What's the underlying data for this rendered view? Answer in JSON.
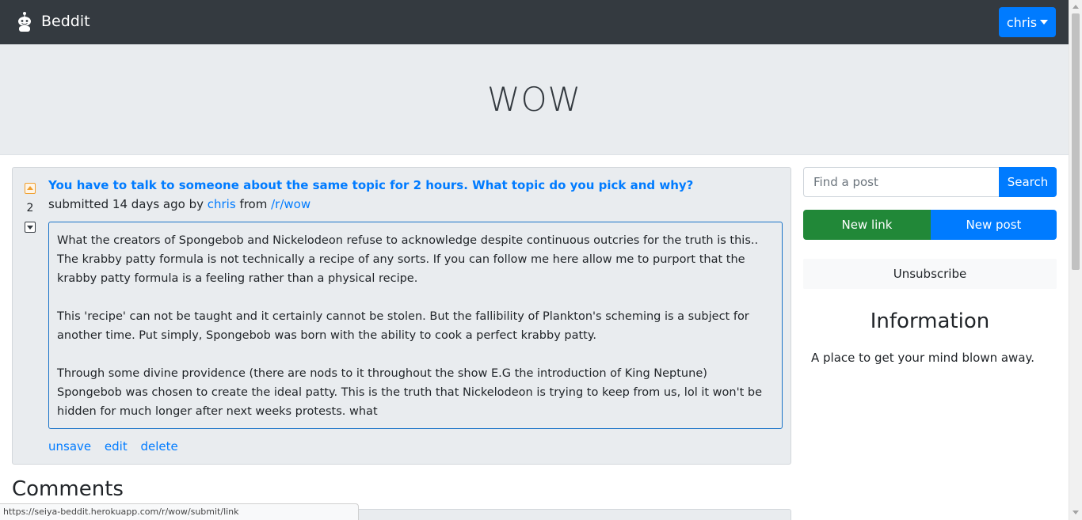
{
  "navbar": {
    "brand": "Beddit",
    "brand_icon": "reddit-alien-icon",
    "user_label": "chris"
  },
  "jumbotron": {
    "title": "WOW"
  },
  "post": {
    "votes": "2",
    "title": "You have to talk to someone about the same topic for 2 hours. What topic do you pick and why?",
    "meta_prefix": "submitted 14 days ago by ",
    "author": "chris",
    "meta_from": " from ",
    "subreddit": "/r/wow",
    "body": [
      "What the creators of Spongebob and Nickelodeon refuse to acknowledge despite continuous outcries for the truth is this.. The krabby patty formula is not technically a recipe of any sorts. If you can follow me here allow me to purport that the krabby patty formula is a feeling rather than a physical recipe.",
      "This 'recipe' can not be taught and it certainly cannot be stolen. But the fallibility of Plankton's scheming is a subject for another time. Put simply, Spongebob was born with the ability to cook a perfect krabby patty.",
      "Through some divine providence (there are nods to it throughout the show E.G the introduction of King Neptune) Spongebob was chosen to create the ideal patty. This is the truth that Nickelodeon is trying to keep from us, lol it won't be hidden for much longer after next weeks protests. what"
    ],
    "actions": {
      "unsave": "unsave",
      "edit": "edit",
      "delete": "delete"
    }
  },
  "comments": {
    "heading": "Comments"
  },
  "sidebar": {
    "search_placeholder": "Find a post",
    "search_button": "Search",
    "new_link": "New link",
    "new_post": "New post",
    "unsubscribe": "Unsubscribe",
    "info_heading": "Information",
    "info_text": "A place to get your mind blown away."
  },
  "status_bar": {
    "url": "https://seiya-beddit.herokuapp.com/r/wow/submit/link"
  },
  "colors": {
    "navbar": "#343a40",
    "primary": "#007bff",
    "success": "#218838",
    "jumbotron": "#e9ecef"
  }
}
